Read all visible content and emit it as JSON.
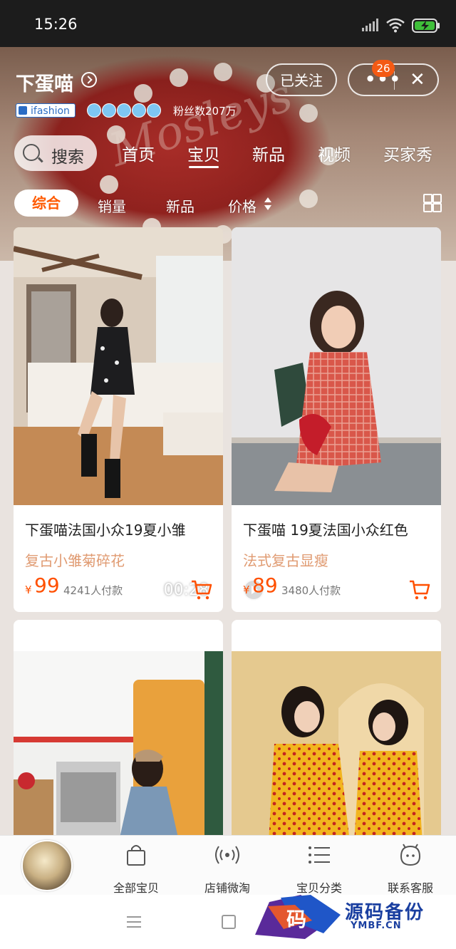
{
  "status_bar": {
    "time": "15:26"
  },
  "shop": {
    "name": "下蛋喵",
    "brand_badge": "ifashion",
    "fans": "粉丝数207万",
    "follow_label": "已关注",
    "notification_count": "26"
  },
  "search": {
    "label": "搜索"
  },
  "nav_tabs": [
    {
      "label": "首页",
      "active": false
    },
    {
      "label": "宝贝",
      "active": true
    },
    {
      "label": "新品",
      "active": false
    },
    {
      "label": "视频",
      "active": false
    },
    {
      "label": "买家秀",
      "active": false
    }
  ],
  "sort": {
    "all": "综合",
    "sales": "销量",
    "new": "新品",
    "price": "价格"
  },
  "products": [
    {
      "title": "下蛋喵法国小众19夏小雏",
      "subtitle": "复古小雏菊碎花",
      "currency": "¥",
      "price": "99",
      "sold": "4241人付款",
      "video_duration": "00:28"
    },
    {
      "title": "下蛋喵 19夏法国小众红色",
      "subtitle": "法式复古显瘦",
      "currency": "¥",
      "price": "89",
      "sold": "3480人付款"
    }
  ],
  "bottom_nav": [
    {
      "label": "全部宝贝",
      "icon": "shopping-bag-icon"
    },
    {
      "label": "店铺微淘",
      "icon": "broadcast-icon"
    },
    {
      "label": "宝贝分类",
      "icon": "category-list-icon"
    },
    {
      "label": "联系客服",
      "icon": "customer-service-icon"
    }
  ],
  "watermark": {
    "logo": "码",
    "cn": "源码备份",
    "en": "YMBF.CN"
  },
  "colors": {
    "accent": "#ff5000",
    "subtitle": "#e09b72",
    "status_bar": "#1c1c1c"
  }
}
